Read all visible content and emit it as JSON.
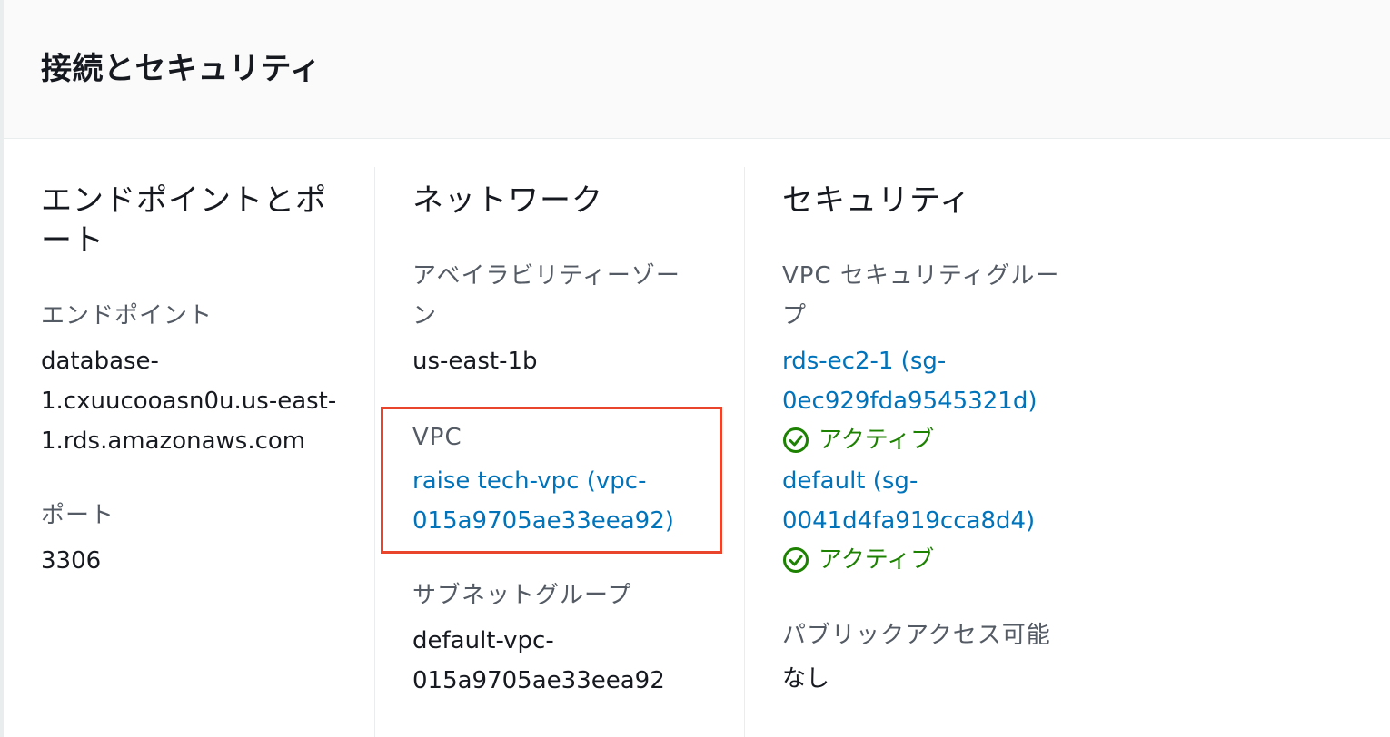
{
  "panel": {
    "title": "接続とセキュリティ"
  },
  "endpoint_section": {
    "title_line1": "エンドポイントとポ",
    "title_line2": "ート",
    "endpoint_label": "エンドポイント",
    "endpoint_lines": [
      "database-",
      "1.cxuucooasn0u.us-east-",
      "1.rds.amazonaws.com"
    ],
    "port_label": "ポート",
    "port_value": "3306"
  },
  "network_section": {
    "title": "ネットワーク",
    "az_label_line1": "アベイラビリティーゾー",
    "az_label_line2": "ン",
    "az_value": "us-east-1b",
    "vpc_label": "VPC",
    "vpc_link_lines": [
      "raise tech-vpc (vpc-",
      "015a9705ae33eea92)"
    ],
    "subnet_label": "サブネットグループ",
    "subnet_lines": [
      "default-vpc-",
      "015a9705ae33eea92"
    ]
  },
  "security_section": {
    "title": "セキュリティ",
    "sg_label_line1": "VPC セキュリティグルー",
    "sg_label_line2": "プ",
    "groups": [
      {
        "link_lines": [
          "rds-ec2-1 (sg-",
          "0ec929fda9545321d)"
        ],
        "status": "アクティブ"
      },
      {
        "link_lines": [
          "default (sg-",
          "0041d4fa919cca8d4)"
        ],
        "status": "アクティブ"
      }
    ],
    "public_label": "パブリックアクセス可能",
    "public_value": "なし"
  },
  "colors": {
    "link": "#0073bb",
    "active": "#1d8102",
    "highlight_border": "#e8452c"
  },
  "icons": {
    "status": "check-circle-icon"
  }
}
